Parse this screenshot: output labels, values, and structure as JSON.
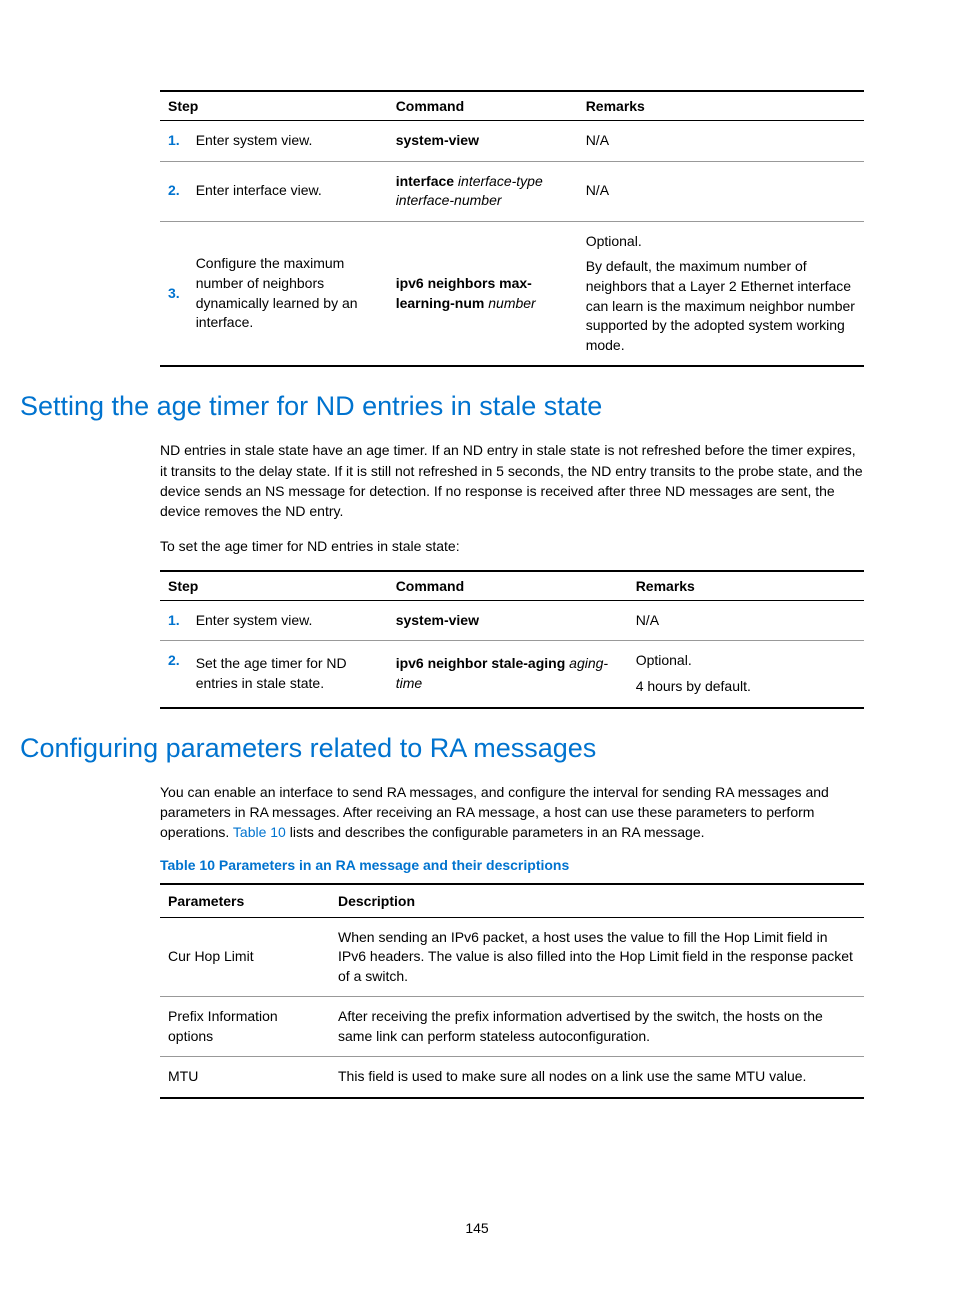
{
  "tables": {
    "t1": {
      "head": {
        "step": "Step",
        "command": "Command",
        "remarks": "Remarks"
      },
      "rows": [
        {
          "num": "1.",
          "desc": "Enter system view.",
          "cmd_b": "system-view",
          "remarks": "N/A"
        },
        {
          "num": "2.",
          "desc": "Enter interface view.",
          "cmd_b": "interface",
          "cmd_i": " interface-type interface-number",
          "remarks": "N/A"
        },
        {
          "num": "3.",
          "desc": "Configure the maximum number of neighbors dynamically learned by an interface.",
          "cmd_b": "ipv6 neighbors max-learning-num",
          "cmd_i": " number",
          "remarks_opt": "Optional.",
          "remarks_body": "By default, the maximum number of neighbors that a Layer 2 Ethernet interface can learn is the maximum neighbor number supported by the adopted system working mode."
        }
      ]
    },
    "t2": {
      "head": {
        "step": "Step",
        "command": "Command",
        "remarks": "Remarks"
      },
      "rows": [
        {
          "num": "1.",
          "desc": "Enter system view.",
          "cmd_b": "system-view",
          "remarks": "N/A"
        },
        {
          "num": "2.",
          "desc": "Set the age timer for ND entries in stale state.",
          "cmd_b": "ipv6 neighbor stale-aging",
          "cmd_i": " aging-time",
          "remarks_opt": "Optional.",
          "remarks_body": "4 hours by default."
        }
      ]
    },
    "t3": {
      "caption": "Table 10 Parameters in an RA message and their descriptions",
      "head": {
        "param": "Parameters",
        "desc": "Description"
      },
      "rows": [
        {
          "param": "Cur Hop Limit",
          "desc": "When sending an IPv6 packet, a host uses the value to fill the Hop Limit field in IPv6 headers. The value is also filled into the Hop Limit field in the response packet of a switch."
        },
        {
          "param": "Prefix Information options",
          "desc": "After receiving the prefix information advertised by the switch, the hosts on the same link can perform stateless autoconfiguration."
        },
        {
          "param": "MTU",
          "desc": "This field is used to make sure all nodes on a link use the same MTU value."
        }
      ]
    }
  },
  "sections": {
    "s1": {
      "title": "Setting the age timer for ND entries in stale state",
      "p1": "ND entries in stale state have an age timer. If an ND entry in stale state is not refreshed before the timer expires, it transits to the delay state. If it is still not refreshed in 5 seconds, the ND entry transits to the probe state, and the device sends an NS message for detection. If no response is received after three ND messages are sent, the device removes the ND entry.",
      "p2": "To set the age timer for ND entries in stale state:"
    },
    "s2": {
      "title": "Configuring parameters related to RA messages",
      "p1_pre": "You can enable an interface to send RA messages, and configure the interval for sending RA messages and parameters in RA messages. After receiving an RA message, a host can use these parameters to perform operations. ",
      "p1_link": "Table 10",
      "p1_post": " lists and describes the configurable parameters in an RA message."
    }
  },
  "page_number": "145"
}
